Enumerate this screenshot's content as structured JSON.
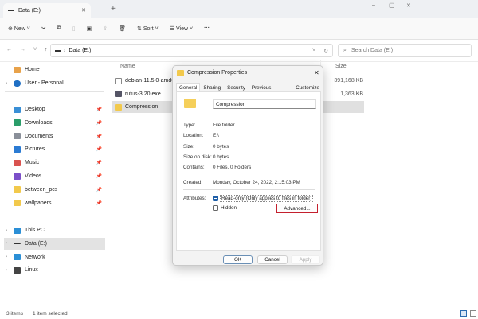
{
  "window": {
    "tab_title": "Data (E:)",
    "new_tab": "+",
    "minimize": "–",
    "maximize": "▢",
    "close": "✕"
  },
  "toolbar": {
    "new_label": "New",
    "sort_label": "Sort",
    "view_label": "View",
    "more": "···"
  },
  "address": {
    "path": "Data (E:)",
    "search_placeholder": "Search Data (E:)"
  },
  "nav": {
    "top": [
      {
        "label": "Home"
      },
      {
        "label": "User - Personal"
      }
    ],
    "quick": [
      {
        "label": "Desktop",
        "color": "#3a8fd6"
      },
      {
        "label": "Downloads",
        "color": "#2a9d6a"
      },
      {
        "label": "Documents",
        "color": "#8a8f99"
      },
      {
        "label": "Pictures",
        "color": "#2b7bd3"
      },
      {
        "label": "Music",
        "color": "#d9534f"
      },
      {
        "label": "Videos",
        "color": "#7b4fc9"
      },
      {
        "label": "between_pcs",
        "color": "#f2c94c"
      },
      {
        "label": "wallpapers",
        "color": "#f2c94c"
      }
    ],
    "bottom": [
      {
        "label": "This PC"
      },
      {
        "label": "Data (E:)"
      },
      {
        "label": "Network"
      },
      {
        "label": "Linux"
      }
    ]
  },
  "files": {
    "headers": {
      "name": "Name",
      "size": "Size"
    },
    "rows": [
      {
        "name": "debian-11.5.0-amd64-",
        "size": "391,168 KB"
      },
      {
        "name": "rufus-3.20.exe",
        "size": "1,363 KB"
      },
      {
        "name": "Compression",
        "size": ""
      }
    ]
  },
  "status": {
    "count": "3 items",
    "selected": "1 item selected"
  },
  "dialog": {
    "title": "Compression Properties",
    "close": "✕",
    "tabs": [
      "General",
      "Sharing",
      "Security",
      "Previous Versions",
      "Customize"
    ],
    "name_value": "Compression",
    "props": [
      {
        "label": "Type:",
        "value": "File folder"
      },
      {
        "label": "Location:",
        "value": "E:\\"
      },
      {
        "label": "Size:",
        "value": "0 bytes"
      },
      {
        "label": "Size on disk:",
        "value": "0 bytes"
      },
      {
        "label": "Contains:",
        "value": "0 Files, 0 Folders"
      }
    ],
    "created_label": "Created:",
    "created_value": "Monday, October 24, 2022, 2:15:03 PM",
    "attributes_label": "Attributes:",
    "readonly_label": "Read-only (Only applies to files in folder)",
    "hidden_label": "Hidden",
    "advanced_label": "Advanced...",
    "ok": "OK",
    "cancel": "Cancel",
    "apply": "Apply",
    "highlight_color": "#c4202e"
  }
}
